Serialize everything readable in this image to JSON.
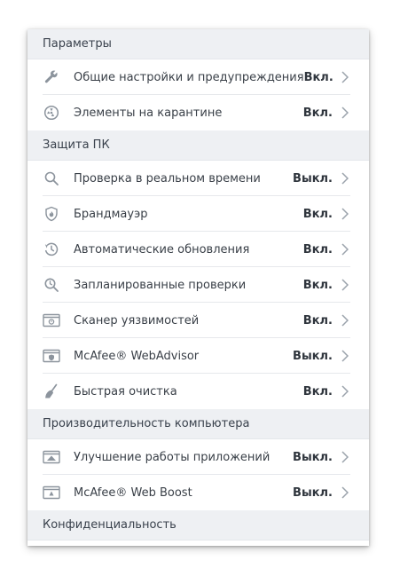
{
  "colors": {
    "icon": "#8c949d",
    "chevron": "#9aa2ab",
    "section_bg": "#eef0f3"
  },
  "sections": [
    {
      "title": "Параметры",
      "items": [
        {
          "label": "Общие настройки и предупреждения",
          "status": "Вкл.",
          "icon": "wrench-icon"
        },
        {
          "label": "Элементы на карантине",
          "status": "Вкл.",
          "icon": "quarantine-icon"
        }
      ]
    },
    {
      "title": "Защита ПК",
      "items": [
        {
          "label": "Проверка в реальном времени",
          "status": "Выкл.",
          "icon": "search-icon"
        },
        {
          "label": "Брандмауэр",
          "status": "Вкл.",
          "icon": "firewall-shield-icon"
        },
        {
          "label": "Автоматические обновления",
          "status": "Вкл.",
          "icon": "update-clock-icon"
        },
        {
          "label": "Запланированные проверки",
          "status": "Вкл.",
          "icon": "scheduled-scan-icon"
        },
        {
          "label": "Сканер уязвимостей",
          "status": "Вкл.",
          "icon": "vulnerability-scanner-icon"
        },
        {
          "label": "McAfee® WebAdvisor",
          "status": "Выкл.",
          "icon": "webadvisor-icon"
        },
        {
          "label": "Быстрая очистка",
          "status": "Вкл.",
          "icon": "broom-icon"
        }
      ]
    },
    {
      "title": "Производительность компьютера",
      "items": [
        {
          "label": "Улучшение работы приложений",
          "status": "Выкл.",
          "icon": "app-boost-icon"
        },
        {
          "label": "McAfee® Web Boost",
          "status": "Выкл.",
          "icon": "web-boost-icon"
        }
      ]
    },
    {
      "title": "Конфиденциальность",
      "items": []
    }
  ]
}
